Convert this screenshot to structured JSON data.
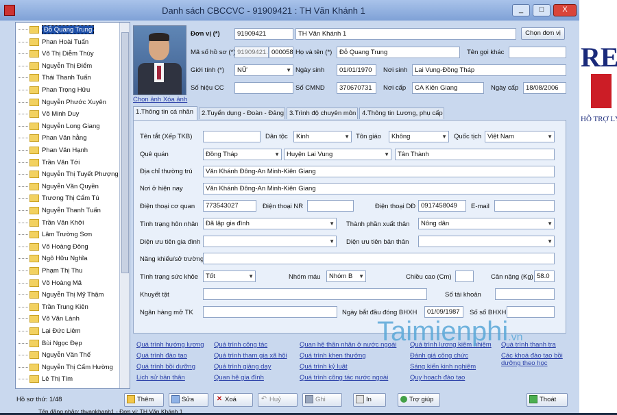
{
  "window": {
    "title": "Danh sách CBCCVC - 91909421 : TH Văn Khánh 1",
    "minimize": "_",
    "maximize": "□",
    "close": "X"
  },
  "tree": {
    "items": [
      "Đỗ Quang Trung",
      "Phan Hoài Tuấn",
      "Võ Thị Diễm Thúy",
      "Nguyễn Thị Điểm",
      "Thái Thanh Tuấn",
      "Phan Trọng Hữu",
      "Nguyễn Phước Xuyên",
      "Võ Minh Duy",
      "Nguyễn Long Giang",
      "Phan Văn hằng",
      "Phan Văn Hạnh",
      "Trần Văn Tới",
      "Nguyễn Thị Tuyết Phượng",
      "Nguyễn Văn Quyền",
      "Trương Thị Cẩm Tú",
      "Nguyễn Thanh Tuấn",
      "Trần Văn Khởi",
      "Lâm Trường Sơn",
      "Võ Hoàng Đông",
      "Ngô Hữu Nghĩa",
      "Phạm Thị Thu",
      "Võ Hoàng Mã",
      "Nguyễn Thị Mỹ Thậm",
      "Trần Trung Kiên",
      "Võ Văn Lành",
      "Lại Đức Liêm",
      "Bùi Ngọc Đẹp",
      "Nguyễn Văn Thế",
      "Nguyễn Thị Cẩm Hường",
      "Lê Thị Tím"
    ]
  },
  "photo": {
    "change_link": "Chọn ảnh Xóa ảnh"
  },
  "header": {
    "don_vi_label": "Đơn vị (*)",
    "don_vi_code": "91909421",
    "don_vi_name": "TH Văn Khánh 1",
    "chon_don_vi": "Chọn đơn vị",
    "ma_so_label": "Mã số hồ sơ (*)",
    "ma_so_prefix": "91909421.",
    "ma_so_value": "000058",
    "ho_ten_label": "Họ và tên (*)",
    "ho_ten": "Đỗ Quang Trung",
    "ten_goi_khac_label": "Tên gọi khác",
    "gioi_tinh_label": "Giới tính (*)",
    "gioi_tinh": "NỮ",
    "ngay_sinh_label": "Ngày sinh",
    "ngay_sinh": "01/01/1970",
    "noi_sinh_label": "Nơi sinh",
    "noi_sinh": "Lai Vung-Đồng Tháp",
    "so_hieu_cc_label": "Số hiệu CC",
    "so_cmnd_label": "Số CMND",
    "so_cmnd": "370670731",
    "noi_cap_label": "Nơi cấp",
    "noi_cap": "CA Kiên Giang",
    "ngay_cap_label": "Ngày cấp",
    "ngay_cap": "18/08/2006"
  },
  "tabs": [
    "1.Thông tin cá nhân",
    "2.Tuyển dụng - Đoàn - Đảng",
    "3.Trình độ chuyên môn",
    "4.Thông tin Lương, phụ cấp"
  ],
  "personal": {
    "ten_tat_label": "Tên tắt (Xếp TKB)",
    "dan_toc_label": "Dân tộc",
    "dan_toc": "Kinh",
    "ton_giao_label": "Tôn giáo",
    "ton_giao": "Không",
    "quoc_tich_label": "Quốc tịch",
    "quoc_tich": "Việt Nam",
    "que_quan_label": "Quê quán",
    "que_tinh": "Đồng Tháp",
    "que_huyen": "Huyện Lai Vung",
    "que_xa": "Tân Thành",
    "dia_chi_label": "Địa chỉ thường trú",
    "dia_chi": "Văn Khánh Đông-An Minh-Kiên Giang",
    "noi_o_label": "Nơi ở hiện nay",
    "noi_o": "Văn Khánh Đông-An Minh-Kiên Giang",
    "dt_co_quan_label": "Điện thoại cơ quan",
    "dt_co_quan": "773543027",
    "dt_nr_label": "Điện thoại NR",
    "dt_dd_label": "Điện thoại DĐ",
    "dt_dd": "0917458049",
    "email_label": "E-mail",
    "hon_nhan_label": "Tình trạng hôn nhân",
    "hon_nhan": "Đã lập gia đình",
    "xuat_than_label": "Thành phần xuất thân",
    "xuat_than": "Nông dân",
    "dien_uu_tien_gd_label": "Diện ưu tiên gia đình",
    "dien_uu_tien_bt_label": "Diện ưu tiên bản thân",
    "nang_khieu_label": "Năng khiếu/sở trường",
    "suc_khoe_label": "Tình trạng sức khỏe",
    "suc_khoe": "Tốt",
    "nhom_mau_label": "Nhóm máu",
    "nhom_mau": "Nhóm B",
    "chieu_cao_label": "Chiều cao (Cm)",
    "can_nang_label": "Cân nặng (Kg)",
    "can_nang": "58.0",
    "khuyet_tat_label": "Khuyết tật",
    "so_tai_khoan_label": "Số tài khoản",
    "ngan_hang_label": "Ngân hàng mở TK",
    "ngay_bhxh_label": "Ngày bắt đầu đóng BHXH",
    "ngay_bhxh": "01/09/1987",
    "so_bhxh_label": "Số sổ BHXH"
  },
  "links": {
    "col1": [
      "Quá trình hướng lương",
      "Quá trình đào tạo",
      "Quá trình bồi dưỡng",
      "Lịch sử bản thân"
    ],
    "col2": [
      "Quá trình công tác",
      "Quá trình tham gia xã hội",
      "Quá trình giảng dạy",
      "Quan hệ gia đình"
    ],
    "col3": [
      "Quan hệ thân nhân ở nước ngoài",
      "Quá trình khen thưởng",
      "Quá trình kỷ luật",
      "Quá trình công tác nước ngoài"
    ],
    "col4": [
      "Quá trình lương kiêm nhiệm",
      "Đánh giá công chức",
      "Sáng kiến kinh nghiệm",
      "Quy hoạch đào tạo"
    ],
    "col5": [
      "Quá trình thanh tra",
      "Các khoá đào tạo bồi dưỡng theo học"
    ]
  },
  "footer": {
    "record_count": "Hồ sơ thứ: 1/48",
    "them": "Thêm",
    "sua": "Sửa",
    "xoa": "Xoá",
    "huy": "Huỷ",
    "ghi": "Ghi",
    "in": "In",
    "tro_giup": "Trợ giúp",
    "thoat": "Thoát",
    "status": "Tên đăng nhập: thvankhanh1 - Đơn vị: TH Văn Khánh 1"
  },
  "ad": {
    "big": "RE",
    "line": "HỖ TRỢ LÝ GI"
  },
  "watermark": {
    "main": "Taimienphi",
    "suffix": ".vn"
  },
  "colors": {
    "window_bg": "#c9d8ee",
    "panel_bg": "#e9f0fa",
    "link": "#2a3fa8",
    "selection": "#1d4fa8"
  }
}
